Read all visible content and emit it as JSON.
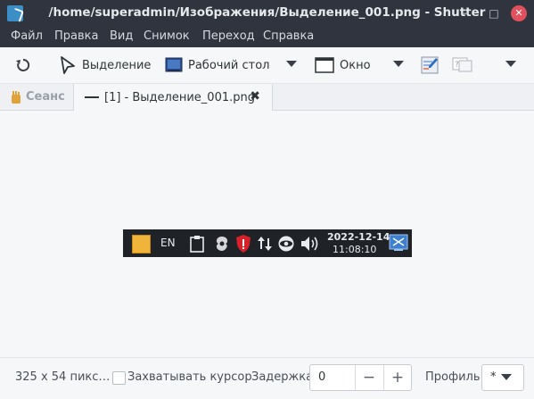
{
  "window": {
    "title": "/home/superadmin/Изображения/Выделение_001.png - Shutter",
    "controls": {
      "minimize": "−",
      "maximize": "□",
      "close": "✕"
    }
  },
  "menu": [
    "Файл",
    "Правка",
    "Вид",
    "Снимок",
    "Переход",
    "Справка"
  ],
  "toolbar": {
    "selection_label": "Выделение",
    "desktop_label": "Рабочий стол",
    "window_label": "Окно"
  },
  "tabs": {
    "session_label": "Сеанс",
    "file_label": "[1] - Выделение_001.png"
  },
  "screenshot": {
    "keyboard_layout": "EN",
    "date": "2022-12-14",
    "time": "11:08:10"
  },
  "status": {
    "size_text": "325 x 54 пикс…",
    "capture_cursor_label": "Захватывать курсор",
    "delay_label": "Задержка:",
    "delay_value": "0",
    "delay_minus": "−",
    "delay_plus": "+",
    "profile_label": "Профиль:",
    "profile_value": "*"
  },
  "colors": {
    "titlebar_bg": "#2f343f",
    "close_button": "#e0515d",
    "taskbar_bg": "#1f2328"
  }
}
